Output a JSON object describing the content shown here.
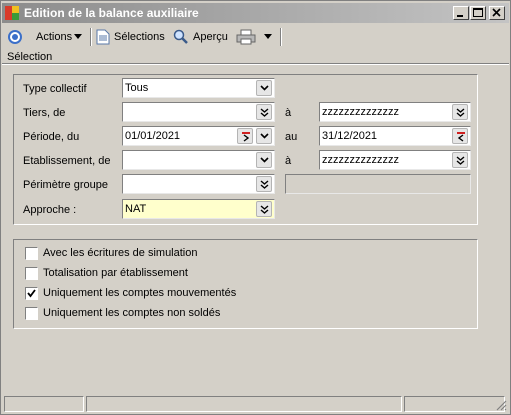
{
  "window": {
    "title": "Edition de la balance auxiliaire"
  },
  "toolbar": {
    "actions_label": "Actions",
    "selections_label": "Sélections",
    "apercu_label": "Aperçu"
  },
  "group": {
    "caption": "Sélection"
  },
  "form": {
    "type_collectif": {
      "label": "Type collectif",
      "value": "Tous"
    },
    "tiers": {
      "label": "Tiers, de",
      "from": "",
      "to_label": "à",
      "to": "zzzzzzzzzzzzzz"
    },
    "periode": {
      "label": "Période, du",
      "from": "01/01/2021",
      "to_label": "au",
      "to": "31/12/2021"
    },
    "etablissement": {
      "label": "Etablissement, de",
      "from": "",
      "to_label": "à",
      "to": "zzzzzzzzzzzzzz"
    },
    "perimetre": {
      "label": "Périmètre groupe",
      "value": "",
      "extra": ""
    },
    "approche": {
      "label": "Approche :",
      "value": "NAT"
    }
  },
  "options": [
    {
      "label": "Avec les écritures de simulation",
      "checked": false
    },
    {
      "label": "Totalisation par établissement",
      "checked": false
    },
    {
      "label": "Uniquement les comptes mouvementés",
      "checked": true
    },
    {
      "label": "Uniquement les comptes non soldés",
      "checked": false
    }
  ],
  "colors": {
    "yellow_field": "#ffffcc",
    "titlebar": "#8c8c8c"
  }
}
